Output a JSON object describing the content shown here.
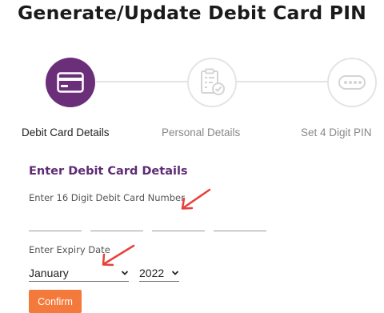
{
  "page": {
    "title": "Generate/Update Debit Card PIN"
  },
  "steps": [
    {
      "label": "Debit Card Details",
      "icon": "credit-card-icon",
      "state": "active"
    },
    {
      "label": "Personal Details",
      "icon": "clipboard-check-icon",
      "state": "inactive"
    },
    {
      "label": "Set 4 Digit PIN",
      "icon": "pin-dots-icon",
      "state": "inactive"
    }
  ],
  "form": {
    "section_title": "Enter Debit Card Details",
    "card_number_label": "Enter 16 Digit Debit Card Number",
    "card_number_fields": [
      "",
      "",
      "",
      ""
    ],
    "expiry_label": "Enter Expiry Date",
    "expiry_month": "January",
    "expiry_year": "2022",
    "confirm_label": "Confirm"
  },
  "colors": {
    "accent": "#6b2f7a",
    "button": "#f47a3c",
    "annotation_arrow": "#e8413a"
  }
}
